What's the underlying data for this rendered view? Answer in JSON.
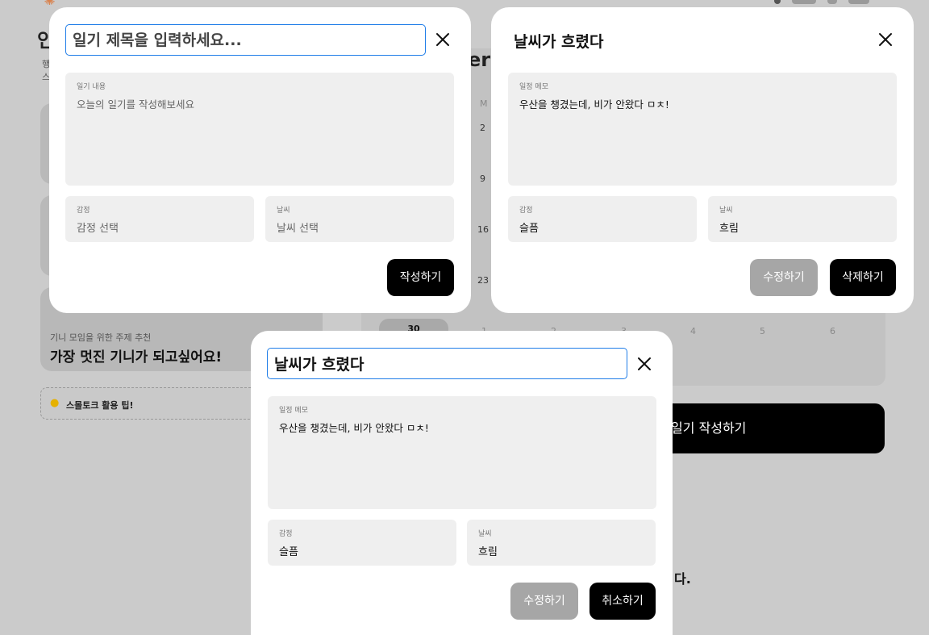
{
  "background": {
    "logo_glyph": "✺",
    "left_title_initial": "인",
    "left_sub_lines": [
      "행",
      "스"
    ],
    "topic_label": "기니 모임을 위한 주제 추천",
    "topic_text": "가장 멋진 기니가 되고싶어요!",
    "tip_text": "스몰토크 활용 팁!",
    "month_fragment": "er",
    "calendar_left_column": [
      "M",
      "2",
      "9",
      "16",
      "23"
    ],
    "calendar_last_row": [
      "30",
      "1",
      "2",
      "3",
      "4",
      "5",
      "6"
    ],
    "write_diary_label": "일기 작성하기",
    "bottom_text": "다."
  },
  "modal_new_diary": {
    "title_placeholder": "일기 제목을 입력하세요...",
    "memo_label": "일기 내용",
    "memo_placeholder": "오늘의 일기를 작성해보세요",
    "emotion_label": "감정",
    "emotion_value": "감정 선택",
    "weather_label": "날씨",
    "weather_value": "날씨 선택",
    "submit_label": "작성하기"
  },
  "modal_view_diary": {
    "title": "날씨가 흐렸다",
    "memo_label": "일정 메모",
    "memo_text": "우산을 챙겼는데, 비가 안왔다 ㅁㅊ!",
    "emotion_label": "감정",
    "emotion_value": "슬픔",
    "weather_label": "날씨",
    "weather_value": "흐림",
    "edit_label": "수정하기",
    "delete_label": "삭제하기"
  },
  "modal_edit_diary": {
    "title_value": "날씨가 흐렸다",
    "memo_label": "일정 메모",
    "memo_text": "우산을 챙겼는데, 비가 안왔다 ㅁㅊ!",
    "emotion_label": "감정",
    "emotion_value": "슬픔",
    "weather_label": "날씨",
    "weather_value": "흐림",
    "edit_label": "수정하기",
    "cancel_label": "취소하기"
  },
  "colors": {
    "accent_focus": "#1f7de8",
    "button_primary": "#000000",
    "button_disabled": "#a6a6a6",
    "overlay": "#cbcbcb"
  }
}
